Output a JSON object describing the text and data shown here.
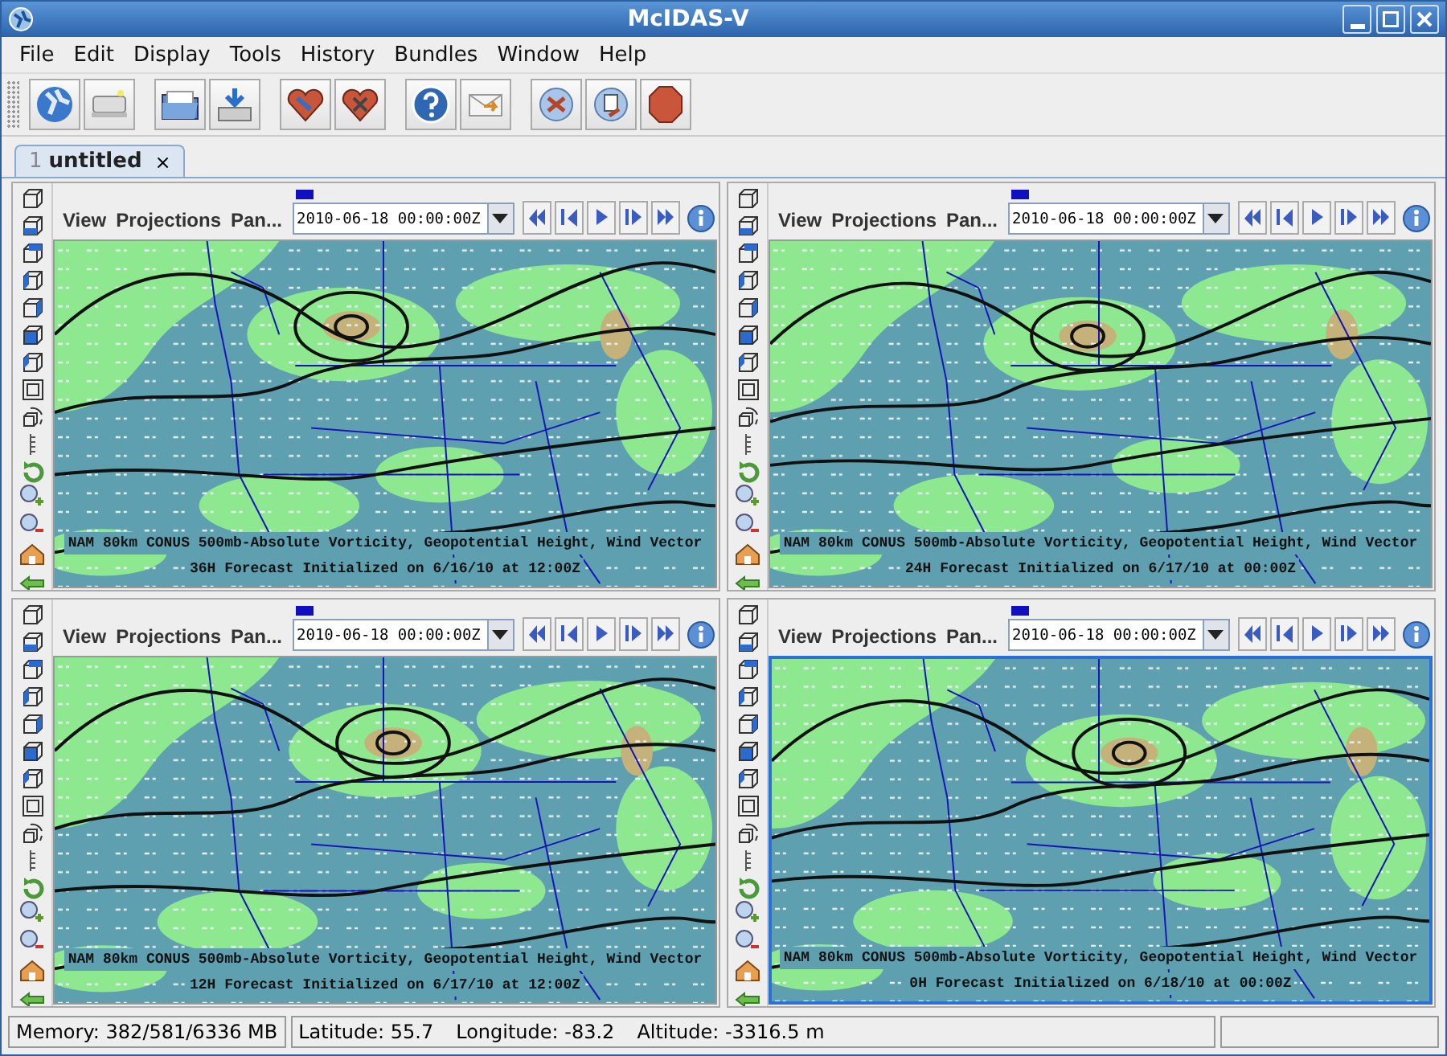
{
  "window": {
    "title": "McIDAS-V"
  },
  "menus": [
    {
      "label": "File"
    },
    {
      "label": "Edit"
    },
    {
      "label": "Display"
    },
    {
      "label": "Tools"
    },
    {
      "label": "History"
    },
    {
      "label": "Bundles"
    },
    {
      "label": "Window"
    },
    {
      "label": "Help"
    }
  ],
  "tabs": [
    {
      "number": "1",
      "label": "untitled",
      "close": "×",
      "selected": true
    }
  ],
  "panels": [
    {
      "menus": [
        "View",
        "Projections",
        "Pan..."
      ],
      "time": "2010-06-18 00:00:00Z",
      "selected": false,
      "caption": [
        "NAM 80km CONUS 500mb-Absolute Vorticity, Geopotential Height, Wind Vector",
        "36H Forecast Initialized on 6/16/10 at 12:00Z"
      ]
    },
    {
      "menus": [
        "View",
        "Projections",
        "Pan..."
      ],
      "time": "2010-06-18 00:00:00Z",
      "selected": false,
      "caption": [
        "NAM 80km CONUS 500mb-Absolute Vorticity, Geopotential Height, Wind Vector",
        "24H Forecast Initialized on 6/17/10 at 00:00Z"
      ]
    },
    {
      "menus": [
        "View",
        "Projections",
        "Pan..."
      ],
      "time": "2010-06-18 00:00:00Z",
      "selected": false,
      "caption": [
        "NAM 80km CONUS 500mb-Absolute Vorticity, Geopotential Height, Wind Vector",
        "12H Forecast Initialized on 6/17/10 at 12:00Z"
      ]
    },
    {
      "menus": [
        "View",
        "Projections",
        "Pan..."
      ],
      "time": "2010-06-18 00:00:00Z",
      "selected": true,
      "caption": [
        "NAM 80km CONUS 500mb-Absolute Vorticity, Geopotential Height, Wind Vector",
        "0H Forecast Initialized on 6/18/10 at 00:00Z"
      ]
    }
  ],
  "status_bar": {
    "memory": "Memory: 382/581/6336 MB",
    "latitude": "Latitude:  55.7",
    "longitude": "Longitude: -83.2",
    "altitude": "Altitude: -3316.5 m"
  }
}
